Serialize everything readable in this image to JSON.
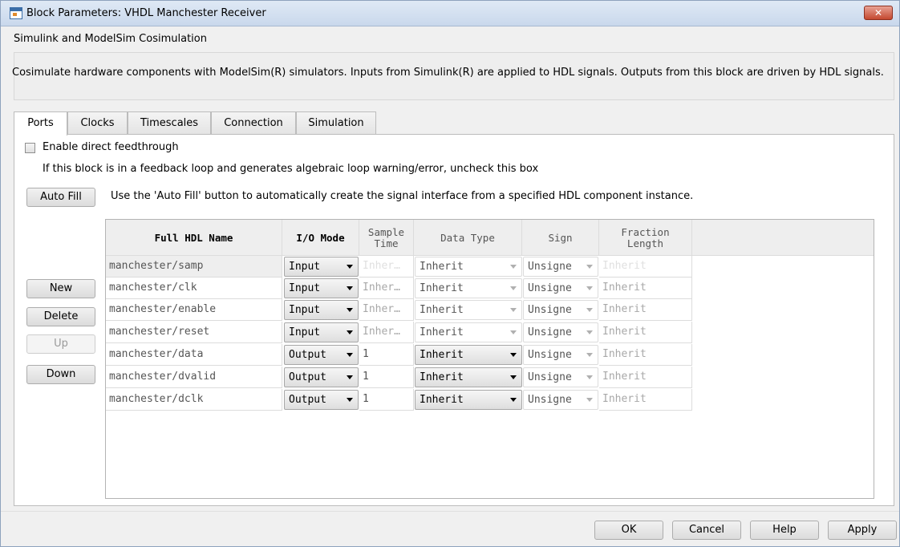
{
  "window": {
    "title": "Block Parameters: VHDL Manchester Receiver",
    "close": "✕"
  },
  "section": {
    "title": "Simulink and ModelSim Cosimulation",
    "description": "Cosimulate hardware components with ModelSim(R) simulators. Inputs from Simulink(R) are applied to HDL signals. Outputs from this block are driven by HDL signals."
  },
  "tabs": [
    "Ports",
    "Clocks",
    "Timescales",
    "Connection",
    "Simulation"
  ],
  "ports": {
    "feedthrough_label": "Enable direct feedthrough",
    "feedthrough_checked": false,
    "hint": "If this block is in a feedback loop and generates algebraic loop warning/error, uncheck this box",
    "autofill_button": "Auto Fill",
    "autofill_hint": "Use the 'Auto Fill' button to automatically create the signal interface from a specified HDL component instance.",
    "side_buttons": {
      "new": "New",
      "delete": "Delete",
      "up": "Up",
      "down": "Down"
    },
    "columns": [
      "Full HDL Name",
      "I/O Mode",
      "Sample Time",
      "Data Type",
      "Sign",
      "Fraction Length"
    ],
    "rows": [
      {
        "name": "manchester/samp",
        "mode": "Input",
        "sample": "Inher…",
        "dtype": "Inherit",
        "sign": "Unsigne",
        "frac": "Inherit"
      },
      {
        "name": "manchester/clk",
        "mode": "Input",
        "sample": "Inher…",
        "dtype": "Inherit",
        "sign": "Unsigne",
        "frac": "Inherit"
      },
      {
        "name": "manchester/enable",
        "mode": "Input",
        "sample": "Inher…",
        "dtype": "Inherit",
        "sign": "Unsigne",
        "frac": "Inherit"
      },
      {
        "name": "manchester/reset",
        "mode": "Input",
        "sample": "Inher…",
        "dtype": "Inherit",
        "sign": "Unsigne",
        "frac": "Inherit"
      },
      {
        "name": "manchester/data",
        "mode": "Output",
        "sample": "1",
        "dtype": "Inherit",
        "sign": "Unsigne",
        "frac": "Inherit"
      },
      {
        "name": "manchester/dvalid",
        "mode": "Output",
        "sample": "1",
        "dtype": "Inherit",
        "sign": "Unsigne",
        "frac": "Inherit"
      },
      {
        "name": "manchester/dclk",
        "mode": "Output",
        "sample": "1",
        "dtype": "Inherit",
        "sign": "Unsigne",
        "frac": "Inherit"
      }
    ]
  },
  "footer": {
    "ok": "OK",
    "cancel": "Cancel",
    "help": "Help",
    "apply": "Apply"
  },
  "colors": {
    "title_bar": "#c9d8ec",
    "close_button": "#c4482f",
    "dialog_bg": "#f0f0f0"
  },
  "icons": {
    "title": "simulink-block-icon",
    "close": "close-icon",
    "dropdown": "chevron-down-icon"
  }
}
